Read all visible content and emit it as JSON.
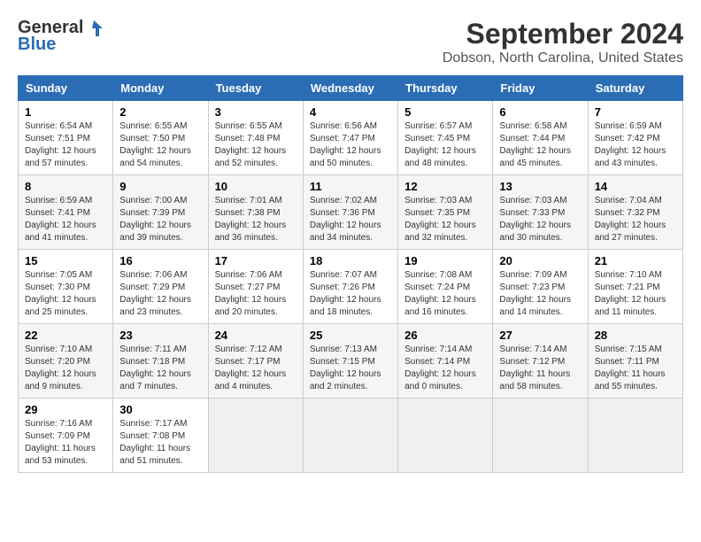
{
  "logo": {
    "line1": "General",
    "line2": "Blue"
  },
  "title": "September 2024",
  "subtitle": "Dobson, North Carolina, United States",
  "headers": [
    "Sunday",
    "Monday",
    "Tuesday",
    "Wednesday",
    "Thursday",
    "Friday",
    "Saturday"
  ],
  "weeks": [
    [
      {
        "day": "1",
        "sunrise": "6:54 AM",
        "sunset": "7:51 PM",
        "daylight": "12 hours and 57 minutes."
      },
      {
        "day": "2",
        "sunrise": "6:55 AM",
        "sunset": "7:50 PM",
        "daylight": "12 hours and 54 minutes."
      },
      {
        "day": "3",
        "sunrise": "6:55 AM",
        "sunset": "7:48 PM",
        "daylight": "12 hours and 52 minutes."
      },
      {
        "day": "4",
        "sunrise": "6:56 AM",
        "sunset": "7:47 PM",
        "daylight": "12 hours and 50 minutes."
      },
      {
        "day": "5",
        "sunrise": "6:57 AM",
        "sunset": "7:45 PM",
        "daylight": "12 hours and 48 minutes."
      },
      {
        "day": "6",
        "sunrise": "6:58 AM",
        "sunset": "7:44 PM",
        "daylight": "12 hours and 45 minutes."
      },
      {
        "day": "7",
        "sunrise": "6:59 AM",
        "sunset": "7:42 PM",
        "daylight": "12 hours and 43 minutes."
      }
    ],
    [
      {
        "day": "8",
        "sunrise": "6:59 AM",
        "sunset": "7:41 PM",
        "daylight": "12 hours and 41 minutes."
      },
      {
        "day": "9",
        "sunrise": "7:00 AM",
        "sunset": "7:39 PM",
        "daylight": "12 hours and 39 minutes."
      },
      {
        "day": "10",
        "sunrise": "7:01 AM",
        "sunset": "7:38 PM",
        "daylight": "12 hours and 36 minutes."
      },
      {
        "day": "11",
        "sunrise": "7:02 AM",
        "sunset": "7:36 PM",
        "daylight": "12 hours and 34 minutes."
      },
      {
        "day": "12",
        "sunrise": "7:03 AM",
        "sunset": "7:35 PM",
        "daylight": "12 hours and 32 minutes."
      },
      {
        "day": "13",
        "sunrise": "7:03 AM",
        "sunset": "7:33 PM",
        "daylight": "12 hours and 30 minutes."
      },
      {
        "day": "14",
        "sunrise": "7:04 AM",
        "sunset": "7:32 PM",
        "daylight": "12 hours and 27 minutes."
      }
    ],
    [
      {
        "day": "15",
        "sunrise": "7:05 AM",
        "sunset": "7:30 PM",
        "daylight": "12 hours and 25 minutes."
      },
      {
        "day": "16",
        "sunrise": "7:06 AM",
        "sunset": "7:29 PM",
        "daylight": "12 hours and 23 minutes."
      },
      {
        "day": "17",
        "sunrise": "7:06 AM",
        "sunset": "7:27 PM",
        "daylight": "12 hours and 20 minutes."
      },
      {
        "day": "18",
        "sunrise": "7:07 AM",
        "sunset": "7:26 PM",
        "daylight": "12 hours and 18 minutes."
      },
      {
        "day": "19",
        "sunrise": "7:08 AM",
        "sunset": "7:24 PM",
        "daylight": "12 hours and 16 minutes."
      },
      {
        "day": "20",
        "sunrise": "7:09 AM",
        "sunset": "7:23 PM",
        "daylight": "12 hours and 14 minutes."
      },
      {
        "day": "21",
        "sunrise": "7:10 AM",
        "sunset": "7:21 PM",
        "daylight": "12 hours and 11 minutes."
      }
    ],
    [
      {
        "day": "22",
        "sunrise": "7:10 AM",
        "sunset": "7:20 PM",
        "daylight": "12 hours and 9 minutes."
      },
      {
        "day": "23",
        "sunrise": "7:11 AM",
        "sunset": "7:18 PM",
        "daylight": "12 hours and 7 minutes."
      },
      {
        "day": "24",
        "sunrise": "7:12 AM",
        "sunset": "7:17 PM",
        "daylight": "12 hours and 4 minutes."
      },
      {
        "day": "25",
        "sunrise": "7:13 AM",
        "sunset": "7:15 PM",
        "daylight": "12 hours and 2 minutes."
      },
      {
        "day": "26",
        "sunrise": "7:14 AM",
        "sunset": "7:14 PM",
        "daylight": "12 hours and 0 minutes."
      },
      {
        "day": "27",
        "sunrise": "7:14 AM",
        "sunset": "7:12 PM",
        "daylight": "11 hours and 58 minutes."
      },
      {
        "day": "28",
        "sunrise": "7:15 AM",
        "sunset": "7:11 PM",
        "daylight": "11 hours and 55 minutes."
      }
    ],
    [
      {
        "day": "29",
        "sunrise": "7:16 AM",
        "sunset": "7:09 PM",
        "daylight": "11 hours and 53 minutes."
      },
      {
        "day": "30",
        "sunrise": "7:17 AM",
        "sunset": "7:08 PM",
        "daylight": "11 hours and 51 minutes."
      },
      null,
      null,
      null,
      null,
      null
    ]
  ]
}
